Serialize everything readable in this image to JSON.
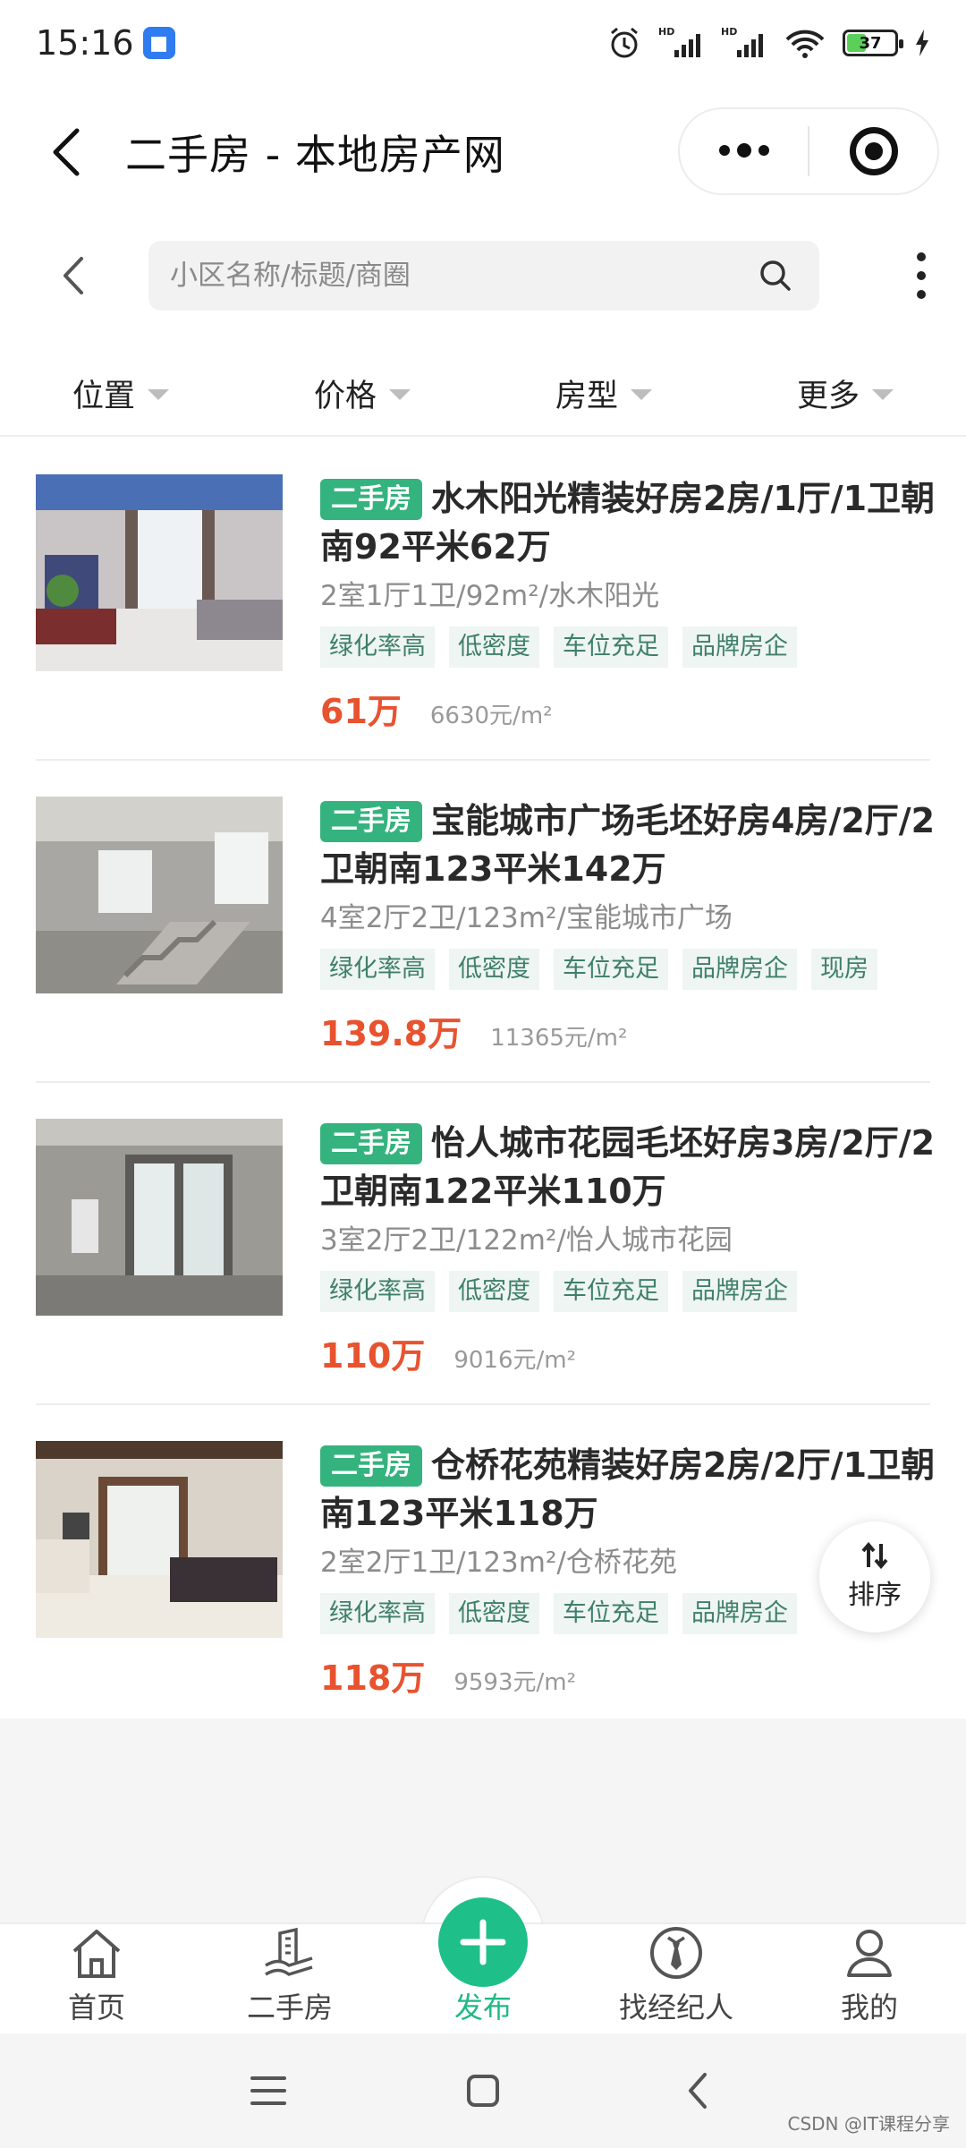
{
  "status_bar": {
    "time": "15:16",
    "battery": "37",
    "network_1": "HD",
    "network_2": "HD"
  },
  "header": {
    "title": "二手房 - 本地房产网"
  },
  "search": {
    "placeholder": "小区名称/标题/商圈"
  },
  "filters": [
    "位置",
    "价格",
    "房型",
    "更多"
  ],
  "listings": [
    {
      "badge": "二手房",
      "title": "水木阳光精装好房2房/1厅/1卫朝南92平米62万",
      "subtitle": "2室1厅1卫/92m²/水木阳光",
      "tags": [
        "绿化率高",
        "低密度",
        "车位充足",
        "品牌房企"
      ],
      "price": "61万",
      "unit_price": "6630元/m²"
    },
    {
      "badge": "二手房",
      "title": "宝能城市广场毛坯好房4房/2厅/2卫朝南123平米142万",
      "subtitle": "4室2厅2卫/123m²/宝能城市广场",
      "tags": [
        "绿化率高",
        "低密度",
        "车位充足",
        "品牌房企",
        "现房"
      ],
      "price": "139.8万",
      "unit_price": "11365元/m²"
    },
    {
      "badge": "二手房",
      "title": "怡人城市花园毛坯好房3房/2厅/2卫朝南122平米110万",
      "subtitle": "3室2厅2卫/122m²/怡人城市花园",
      "tags": [
        "绿化率高",
        "低密度",
        "车位充足",
        "品牌房企"
      ],
      "price": "110万",
      "unit_price": "9016元/m²"
    },
    {
      "badge": "二手房",
      "title": "仓桥花苑精装好房2房/2厅/1卫朝南123平米118万",
      "subtitle": "2室2厅1卫/123m²/仓桥花苑",
      "tags": [
        "绿化率高",
        "低密度",
        "车位充足",
        "品牌房企"
      ],
      "price": "118万",
      "unit_price": "9593元/m²"
    }
  ],
  "sort_button": {
    "label": "排序"
  },
  "tab_bar": {
    "items": [
      {
        "label": "首页",
        "icon": "home-icon"
      },
      {
        "label": "二手房",
        "icon": "building-icon"
      },
      {
        "label": "发布",
        "icon": "plus-icon"
      },
      {
        "label": "找经纪人",
        "icon": "agent-tie-icon"
      },
      {
        "label": "我的",
        "icon": "user-icon"
      }
    ]
  },
  "watermark": "CSDN @IT课程分享",
  "colors": {
    "accent": "#1fbf8a",
    "price": "#e8532f",
    "badge": "#35b37e"
  }
}
